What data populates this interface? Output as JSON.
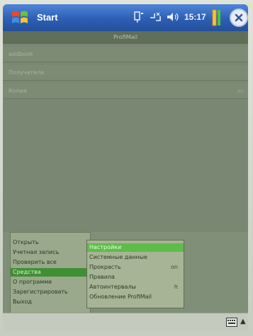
{
  "titlebar": {
    "start_label": "Start",
    "clock": "15:17"
  },
  "app": {
    "header": "ProfiMail"
  },
  "fields": [
    {
      "label": "addbook",
      "value": ""
    },
    {
      "label": "Получатели",
      "value": ""
    },
    {
      "label": "Копия",
      "value": "en"
    }
  ],
  "menu": {
    "items": [
      {
        "label": "Открыть"
      },
      {
        "label": "Учетная запись"
      },
      {
        "label": "Проверить все"
      },
      {
        "label": "Средства"
      },
      {
        "label": "О программе"
      },
      {
        "label": "Зарегистрировать"
      },
      {
        "label": "Выход"
      }
    ],
    "selected_index": 3
  },
  "submenu": {
    "items": [
      {
        "label": "Настройки",
        "extra": ""
      },
      {
        "label": "Системные данные",
        "extra": ""
      },
      {
        "label": "Прокрасть",
        "extra": "on"
      },
      {
        "label": "Правила",
        "extra": ""
      },
      {
        "label": "Автоинтервалы",
        "extra": "ft"
      },
      {
        "label": "Обновление ProfiMail",
        "extra": ""
      }
    ],
    "highlighted_index": 0
  },
  "icons": {
    "start": "windows-flag-icon",
    "tray": [
      "connectivity-icon",
      "signal-icon",
      "volume-icon",
      "battery-icon"
    ],
    "close": "close-icon",
    "keyboard": "keyboard-icon"
  },
  "colors": {
    "titlebar": "#2d5fb4",
    "selection": "#3f8f33",
    "highlight": "#5dbd4a"
  }
}
